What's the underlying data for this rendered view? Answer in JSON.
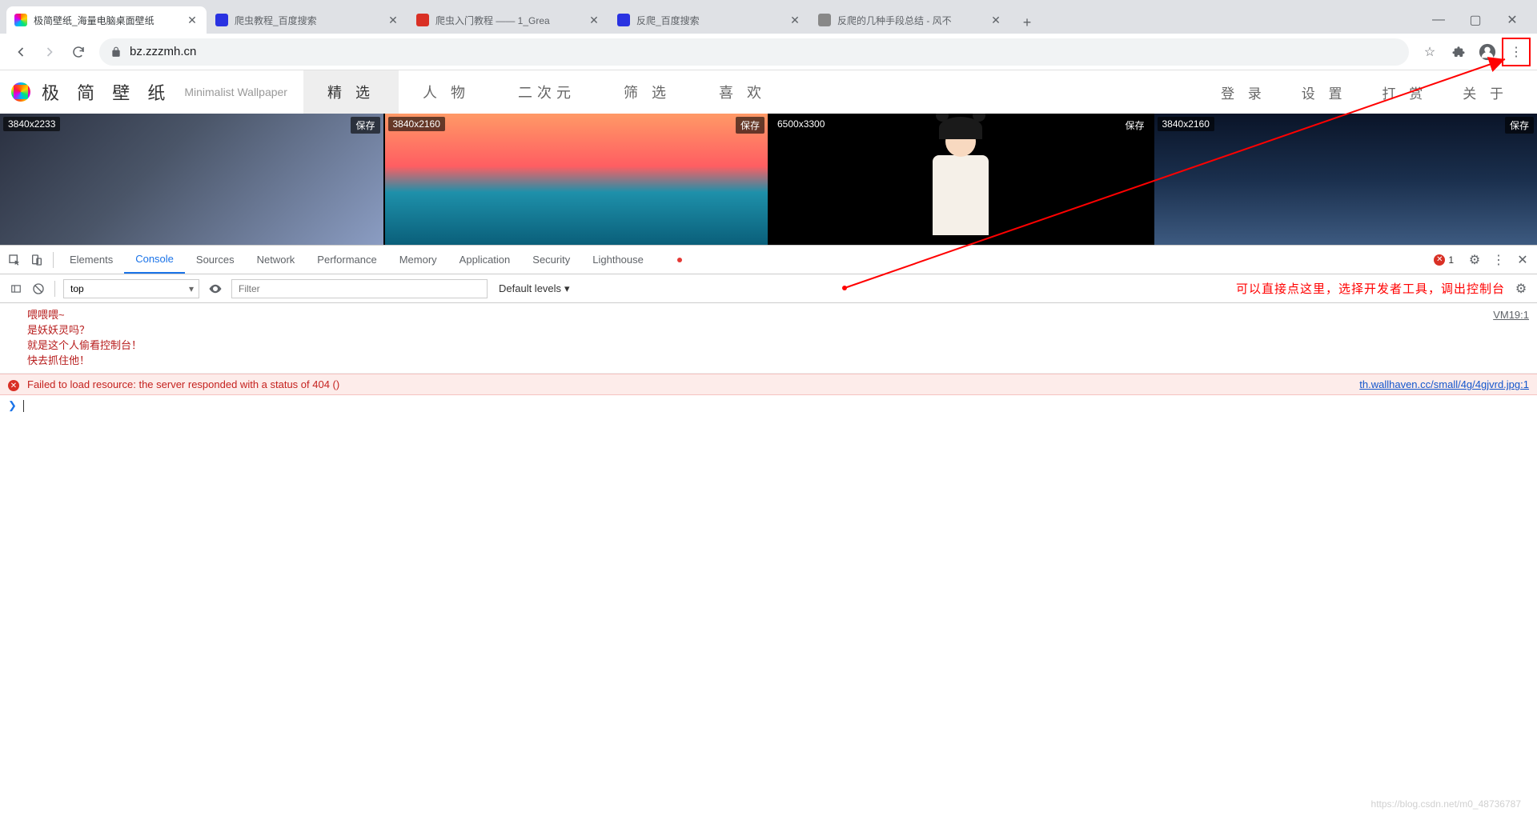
{
  "tabs": [
    {
      "title": "极简壁纸_海量电脑桌面壁纸",
      "active": true
    },
    {
      "title": "爬虫教程_百度搜索",
      "active": false
    },
    {
      "title": "爬虫入门教程 —— 1_Grea",
      "active": false
    },
    {
      "title": "反爬_百度搜索",
      "active": false
    },
    {
      "title": "反爬的几种手段总结 - 风不",
      "active": false
    }
  ],
  "url": "bz.zzzmh.cn",
  "site": {
    "name": "极 简 壁 纸",
    "sub": "Minimalist Wallpaper",
    "nav": [
      "精 选",
      "人 物",
      "二次元",
      "筛 选",
      "喜 欢"
    ],
    "right": [
      "登 录",
      "设 置",
      "打 赏",
      "关 于"
    ]
  },
  "wallpapers": [
    {
      "res": "3840x2233",
      "save": "保存"
    },
    {
      "res": "3840x2160",
      "save": "保存"
    },
    {
      "res": "6500x3300",
      "save": "保存"
    },
    {
      "res": "3840x2160",
      "save": "保存"
    }
  ],
  "devtools": {
    "tabs": [
      "Elements",
      "Console",
      "Sources",
      "Network",
      "Performance",
      "Memory",
      "Application",
      "Security",
      "Lighthouse"
    ],
    "active": "Console",
    "errorCount": "1",
    "context": "top",
    "filterPlaceholder": "Filter",
    "levels": "Default levels",
    "annotation": "可以直接点这里，选择开发者工具，调出控制台"
  },
  "console": {
    "red1": "喂喂喂~",
    "red2": "是妖妖灵吗？",
    "red3": "就是这个人偷看控制台！",
    "red4": "快去抓住他！",
    "redSrc": "VM19:1",
    "error": "Failed to load resource: the server responded with a status of 404 ()",
    "errorSrc": "th.wallhaven.cc/small/4g/4gjvrd.jpg:1"
  },
  "watermark": "https://blog.csdn.net/m0_48736787"
}
